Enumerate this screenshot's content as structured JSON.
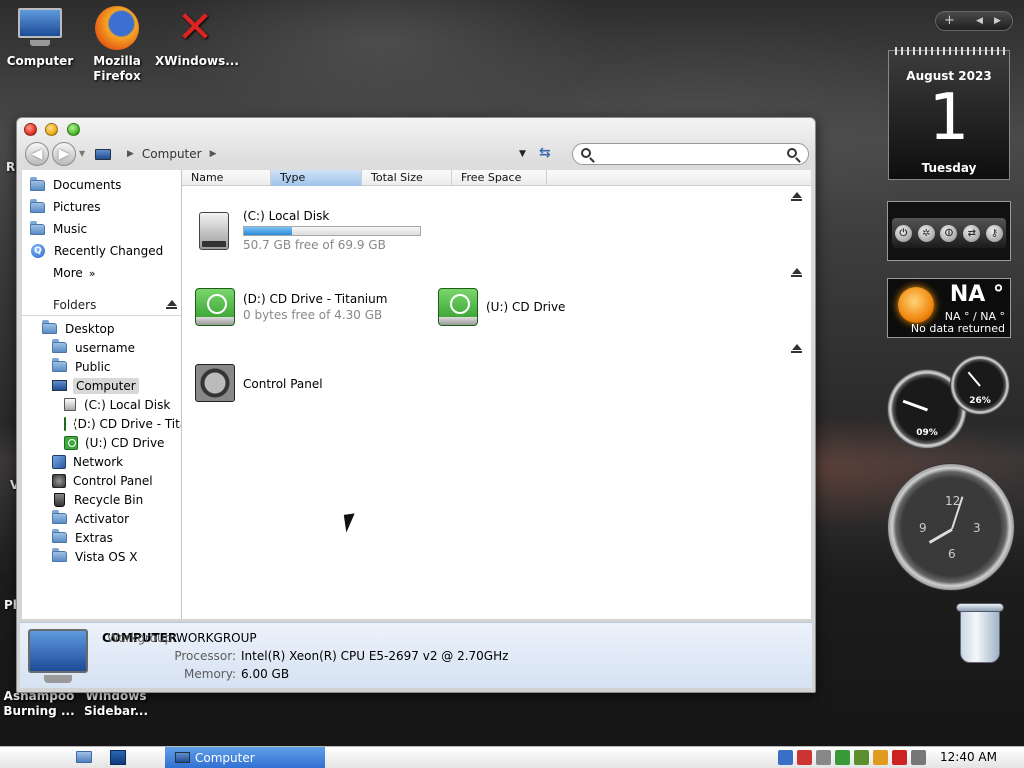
{
  "desktop": {
    "icons": [
      {
        "label": "Computer"
      },
      {
        "label": "Mozilla Firefox"
      },
      {
        "label": "XWindows..."
      },
      {
        "label": "Ashampoo Burning ..."
      },
      {
        "label": "Windows Sidebar..."
      }
    ],
    "partial_labels": [
      "R",
      "V",
      "Ph"
    ]
  },
  "window": {
    "address": {
      "location": "Computer"
    },
    "search": {
      "placeholder": ""
    },
    "favorites": [
      {
        "label": "Documents",
        "icon": "folder-icon"
      },
      {
        "label": "Pictures",
        "icon": "folder-icon"
      },
      {
        "label": "Music",
        "icon": "folder-icon"
      },
      {
        "label": "Recently Changed",
        "icon": "search-icon"
      },
      {
        "label": "More",
        "icon": "chevron-right-icon"
      }
    ],
    "folders_header": "Folders",
    "tree": [
      {
        "label": "Desktop"
      },
      {
        "label": "username"
      },
      {
        "label": "Public"
      },
      {
        "label": "Computer"
      },
      {
        "label": "(C:) Local Disk"
      },
      {
        "label": "(D:) CD Drive - Titanium"
      },
      {
        "label": "(U:) CD Drive"
      },
      {
        "label": "Network"
      },
      {
        "label": "Control Panel"
      },
      {
        "label": "Recycle Bin"
      },
      {
        "label": "Activator"
      },
      {
        "label": "Extras"
      },
      {
        "label": "Vista OS X"
      }
    ],
    "columns": [
      "Name",
      "Type",
      "Total Size",
      "Free Space"
    ],
    "drives": [
      {
        "title": "(C:) Local Disk",
        "subtitle": "50.7 GB free of 69.9 GB",
        "used_fraction": 0.27
      },
      {
        "title": "(D:) CD Drive - Titanium",
        "subtitle": "0 bytes free of 4.30 GB"
      },
      {
        "title": "(U:) CD Drive"
      },
      {
        "title": "Control Panel"
      }
    ],
    "details": {
      "name": "COMPUTER",
      "workgroup_label": "Workgroup:",
      "workgroup": "WORKGROUP",
      "processor_label": "Processor:",
      "processor": "Intel(R) Xeon(R) CPU E5-2697 v2 @ 2.70GHz",
      "memory_label": "Memory:",
      "memory": "6.00 GB"
    }
  },
  "gadgets": {
    "calendar": {
      "month": "August 2023",
      "day": "1",
      "weekday": "Tuesday"
    },
    "weather": {
      "temp": "NA °",
      "range": "NA ° / NA °",
      "note": "No data returned"
    },
    "meters": {
      "cpu": "09%",
      "memory": "26%"
    },
    "clock": {
      "n12": "12",
      "n3": "3",
      "n6": "6",
      "n9": "9"
    }
  },
  "taskbar": {
    "task": "Computer",
    "time": "12:40 AM"
  },
  "colors": {
    "accent": "#2f6ed0",
    "drive_fill": "#2a8ad9"
  }
}
